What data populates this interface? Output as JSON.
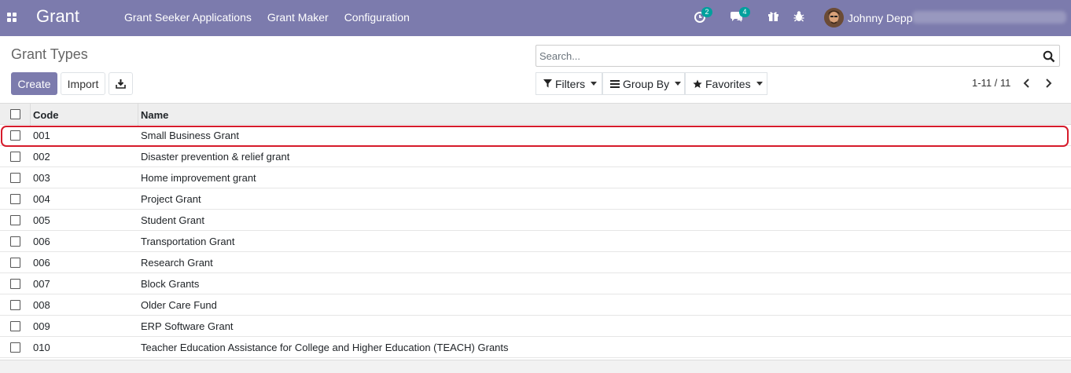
{
  "navbar": {
    "app_title": "Grant",
    "menu": [
      "Grant Seeker Applications",
      "Grant Maker",
      "Configuration"
    ],
    "activity_count": "2",
    "messages_count": "4",
    "user_name": "Johnny Depp"
  },
  "control_panel": {
    "breadcrumb": "Grant Types",
    "create_label": "Create",
    "import_label": "Import",
    "search_placeholder": "Search...",
    "filters_label": "Filters",
    "group_by_label": "Group By",
    "favorites_label": "Favorites",
    "pager_value": "1-11 / 11"
  },
  "list": {
    "columns": [
      "Code",
      "Name"
    ],
    "rows": [
      {
        "code": "001",
        "name": "Small Business Grant"
      },
      {
        "code": "002",
        "name": "Disaster prevention & relief grant"
      },
      {
        "code": "003",
        "name": "Home improvement grant"
      },
      {
        "code": "004",
        "name": "Project Grant"
      },
      {
        "code": "005",
        "name": "Student Grant"
      },
      {
        "code": "006",
        "name": "Transportation Grant"
      },
      {
        "code": "006",
        "name": "Research Grant"
      },
      {
        "code": "007",
        "name": "Block Grants"
      },
      {
        "code": "008",
        "name": "Older Care Fund"
      },
      {
        "code": "009",
        "name": "ERP Software Grant"
      },
      {
        "code": "010",
        "name": "Teacher Education Assistance for College and Higher Education (TEACH) Grants"
      }
    ]
  },
  "colors": {
    "navbar": "#7c7bad",
    "primary_button": "#7c7bad",
    "badge": "#00a09d",
    "highlight": "#d61b2b"
  }
}
